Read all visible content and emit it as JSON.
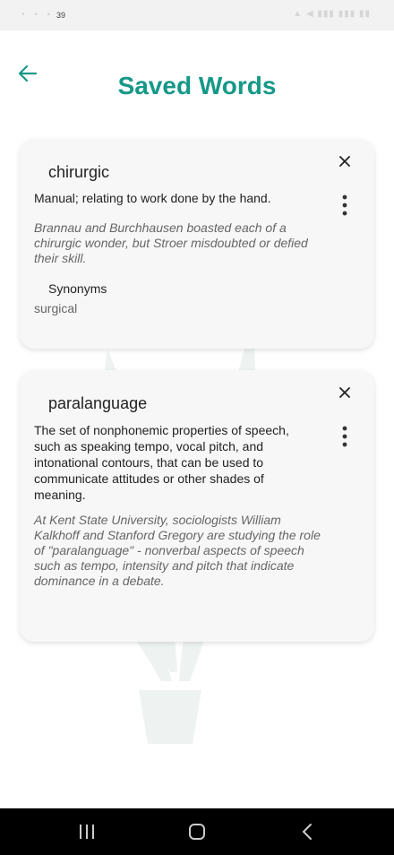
{
  "status_bar": {
    "time": "39"
  },
  "header": {
    "title": "Saved Words"
  },
  "cards": [
    {
      "word": "chirurgic",
      "definition": "Manual; relating to work done by the hand.",
      "example": "Brannau and Burchhausen boasted each of a chirurgic wonder, but Stroer misdoubted or defied their skill.",
      "synonyms_label": "Synonyms",
      "synonyms": "surgical"
    },
    {
      "word": "paralanguage",
      "definition": "The set of nonphonemic properties of speech, such as speaking tempo, vocal pitch, and intonational contours, that can be used to communicate attitudes or other shades of meaning.",
      "example": "At Kent State University, sociologists William Kalkhoff and Stanford Gregory are studying the role of \"paralanguage\" - nonverbal aspects of speech such as tempo, intensity and pitch that indicate dominance in a debate."
    }
  ],
  "colors": {
    "accent": "#169888",
    "card": "#f7f7f7"
  }
}
